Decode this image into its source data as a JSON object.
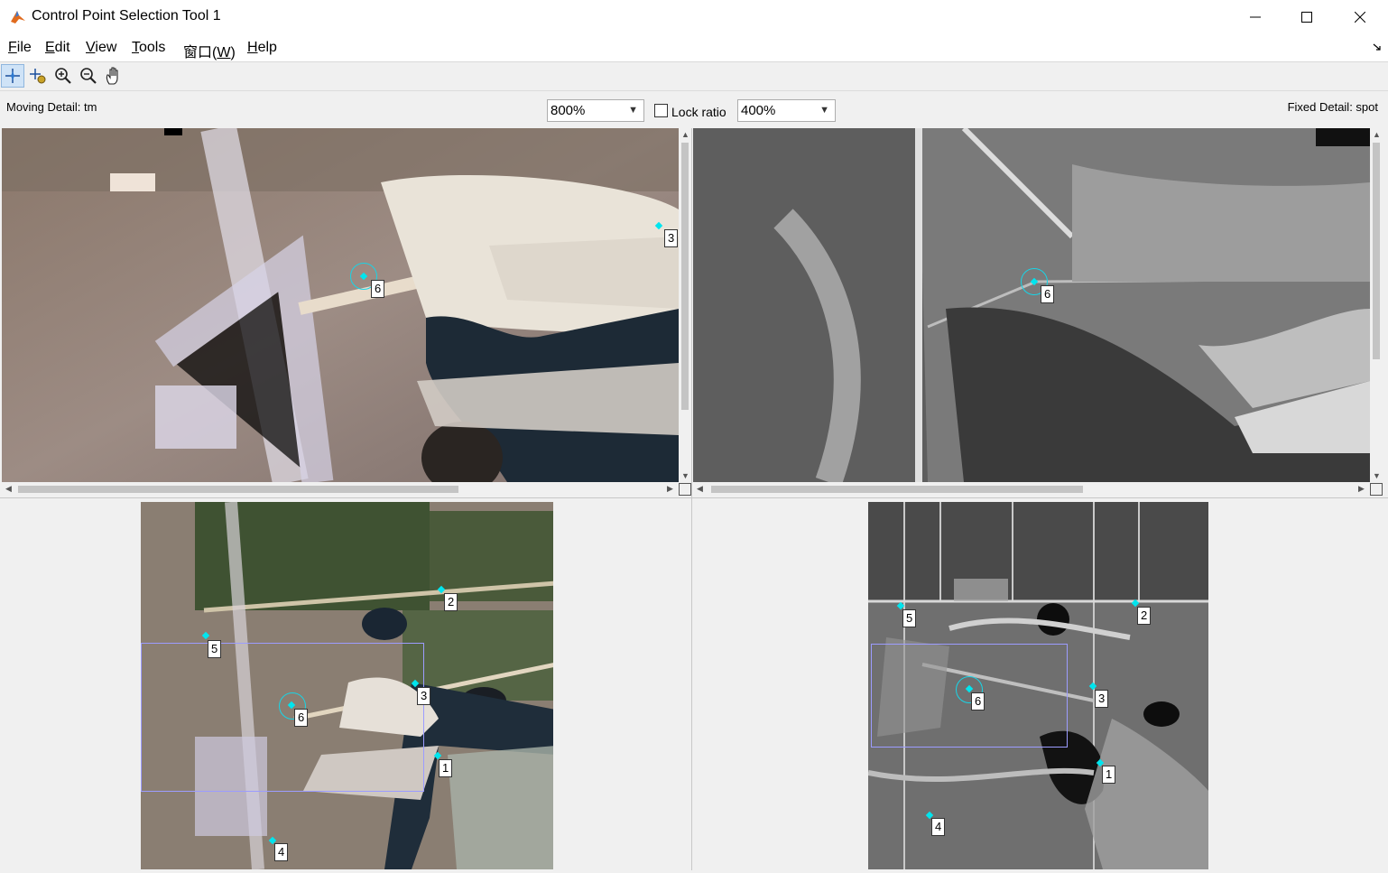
{
  "window": {
    "title": "Control Point Selection Tool 1",
    "min": "—",
    "max": "☐",
    "close": "✕"
  },
  "menu": [
    {
      "pre": "",
      "key": "F",
      "post": "ile"
    },
    {
      "pre": "",
      "key": "E",
      "post": "dit"
    },
    {
      "pre": "",
      "key": "V",
      "post": "iew"
    },
    {
      "pre": "",
      "key": "T",
      "post": "ools"
    },
    {
      "pre": "窗口(",
      "key": "W",
      "post": ")"
    },
    {
      "pre": "",
      "key": "H",
      "post": "elp"
    }
  ],
  "toolbar": {
    "select_icon": "add-point-icon",
    "predict_icon": "predict-point-icon",
    "zoom_in_icon": "zoom-in-icon",
    "zoom_out_icon": "zoom-out-icon",
    "pan_icon": "hand-pan-icon"
  },
  "info": {
    "moving_detail": "Moving Detail: tm",
    "fixed_detail": "Fixed Detail: spot",
    "moving_zoom": "800%",
    "lock_ratio": "Lock ratio",
    "fixed_zoom": "400%"
  },
  "points": {
    "moving_detail": [
      "6",
      "3"
    ],
    "fixed_detail": [
      "6"
    ],
    "moving_overview": [
      "2",
      "5",
      "3",
      "6",
      "1",
      "4"
    ],
    "fixed_overview": [
      "5",
      "2",
      "3",
      "6",
      "1",
      "4"
    ]
  },
  "colors": {
    "point": "#00e5ee",
    "detail_box": "#9c9cff"
  }
}
